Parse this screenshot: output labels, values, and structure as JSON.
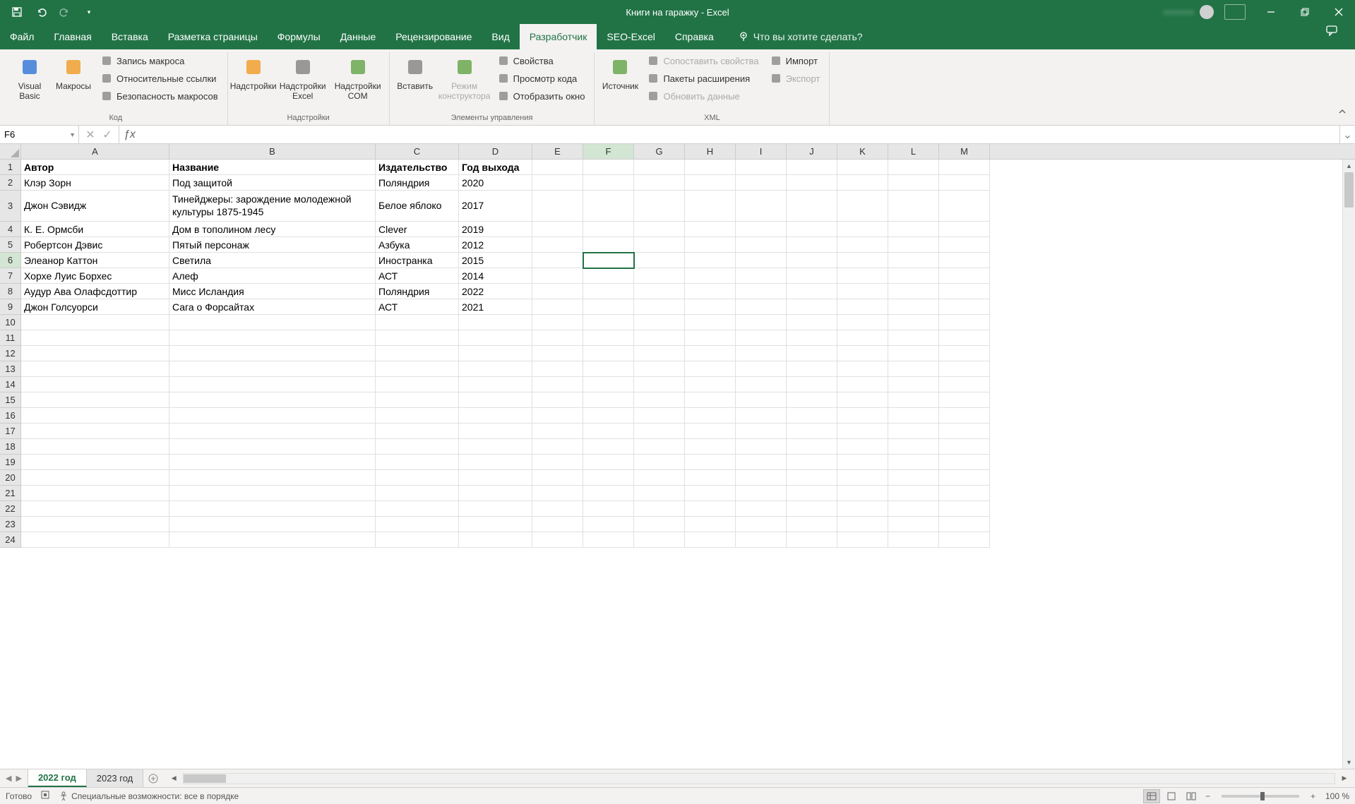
{
  "titlebar": {
    "title": "Книги на гаражку  -  Excel",
    "user_hint": ""
  },
  "menu": {
    "tabs": [
      "Файл",
      "Главная",
      "Вставка",
      "Разметка страницы",
      "Формулы",
      "Данные",
      "Рецензирование",
      "Вид",
      "Разработчик",
      "SEO-Excel",
      "Справка"
    ],
    "active_index": 8,
    "tell_me": "Что вы хотите сделать?"
  },
  "ribbon": {
    "groups": [
      {
        "label": "Код",
        "big": [
          {
            "label": "Visual Basic"
          },
          {
            "label": "Макросы"
          }
        ],
        "small": [
          {
            "label": "Запись макроса"
          },
          {
            "label": "Относительные ссылки"
          },
          {
            "label": "Безопасность макросов"
          }
        ]
      },
      {
        "label": "Надстройки",
        "big": [
          {
            "label": "Надстройки"
          },
          {
            "label": "Надстройки Excel"
          },
          {
            "label": "Надстройки COM"
          }
        ]
      },
      {
        "label": "Элементы управления",
        "big": [
          {
            "label": "Вставить"
          },
          {
            "label": "Режим конструктора",
            "disabled": true
          }
        ],
        "small": [
          {
            "label": "Свойства"
          },
          {
            "label": "Просмотр кода"
          },
          {
            "label": "Отобразить окно"
          }
        ]
      },
      {
        "label": "XML",
        "big": [
          {
            "label": "Источник"
          }
        ],
        "small_cols": [
          [
            {
              "label": "Сопоставить свойства",
              "disabled": true
            },
            {
              "label": "Пакеты расширения"
            },
            {
              "label": "Обновить данные",
              "disabled": true
            }
          ],
          [
            {
              "label": "Импорт"
            },
            {
              "label": "Экспорт",
              "disabled": true
            }
          ]
        ]
      }
    ]
  },
  "formula_bar": {
    "name_box": "F6",
    "formula": ""
  },
  "grid": {
    "columns": [
      "A",
      "B",
      "C",
      "D",
      "E",
      "F",
      "G",
      "H",
      "I",
      "J",
      "K",
      "L",
      "M"
    ],
    "selected_col_index": 5,
    "selected_row": 6,
    "headers": [
      "Автор",
      "Название",
      "Издательство",
      "Год выхода"
    ],
    "rows": [
      {
        "n": 2,
        "a": "Клэр Зорн",
        "b": "Под защитой",
        "c": "Поляндрия",
        "d": "2020"
      },
      {
        "n": 3,
        "a": "Джон Сэвидж",
        "b": "Тинейджеры: зарождение молодежной культуры 1875-1945",
        "c": "Белое яблоко",
        "d": "2017",
        "tall": true
      },
      {
        "n": 4,
        "a": "К. Е. Ормсби",
        "b": "Дом в тополином лесу",
        "c": "Clever",
        "d": "2019"
      },
      {
        "n": 5,
        "a": "Робертсон Дэвис",
        "b": "Пятый персонаж",
        "c": "Азбука",
        "d": "2012"
      },
      {
        "n": 6,
        "a": "Элеанор Каттон",
        "b": "Светила",
        "c": "Иностранка",
        "d": "2015"
      },
      {
        "n": 7,
        "a": "Хорхе Луис Борхес",
        "b": "Алеф",
        "c": "АСТ",
        "d": "2014"
      },
      {
        "n": 8,
        "a": "Аудур Ава Олафсдоттир",
        "b": "Мисс Исландия",
        "c": "Поляндрия",
        "d": "2022"
      },
      {
        "n": 9,
        "a": "Джон Голсуорси",
        "b": "Сага о Форсайтах",
        "c": "АСТ",
        "d": "2021"
      }
    ],
    "empty_rows_from": 10,
    "empty_rows_to": 24
  },
  "sheets": {
    "tabs": [
      "2022 год",
      "2023 год"
    ],
    "active_index": 0
  },
  "status": {
    "ready": "Готово",
    "accessibility": "Специальные возможности: все в порядке",
    "zoom": "100 %"
  }
}
